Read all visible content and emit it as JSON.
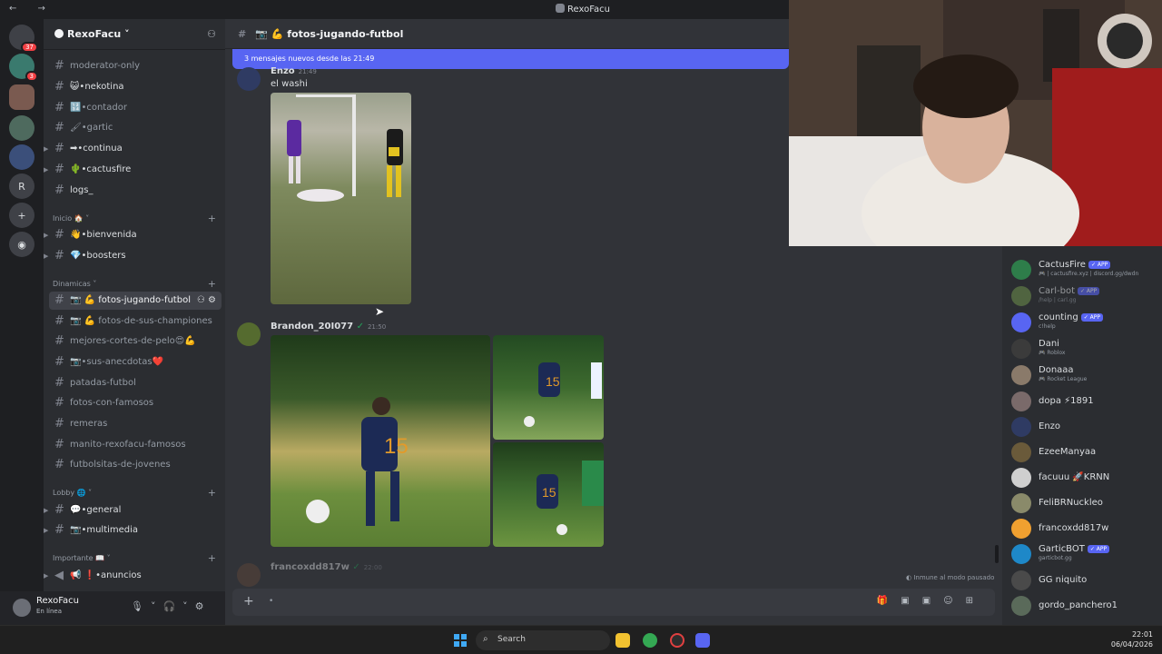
{
  "window": {
    "title": "RexoFacu"
  },
  "guilds": [
    {
      "label": "",
      "badge": "37"
    },
    {
      "label": "",
      "badge": "3"
    },
    {
      "label": "",
      "badge": ""
    },
    {
      "label": "",
      "badge": ""
    },
    {
      "label": "",
      "badge": ""
    },
    {
      "label": "R",
      "badge": ""
    },
    {
      "label": "+",
      "badge": ""
    },
    {
      "label": "",
      "badge": ""
    }
  ],
  "server": {
    "name": "RexoFacu"
  },
  "channels": [
    {
      "name": "moderator-only"
    },
    {
      "name": "😺•nekotina"
    },
    {
      "name": "🔢•contador"
    },
    {
      "name": "🖌•gartic"
    },
    {
      "name": "➡•continua"
    },
    {
      "name": "🌵•cactusfire"
    },
    {
      "name": "logs_"
    }
  ],
  "categories": {
    "inicio": "Inicio 🏠",
    "dinamicas": "Dinamicas",
    "lobby": "Lobby 🌐",
    "importante": "Importante 📖"
  },
  "inicio_channels": [
    {
      "name": "👋•bienvenida"
    },
    {
      "name": "💎•boosters"
    }
  ],
  "dinamicas_channels": [
    {
      "name": "📷 💪 fotos-jugando-futbol"
    },
    {
      "name": "📷 💪 fotos-de-sus-championes"
    },
    {
      "name": "mejores-cortes-de-pelo😍💪"
    },
    {
      "name": "📷•sus-anecdotas❤️"
    },
    {
      "name": "patadas-futbol"
    },
    {
      "name": "fotos-con-famosos"
    },
    {
      "name": "remeras"
    },
    {
      "name": "manito-rexofacu-famosos"
    },
    {
      "name": "futbolsitas-de-jovenes"
    }
  ],
  "lobby_channels": [
    {
      "name": "💬•general"
    },
    {
      "name": "📷•multimedia"
    }
  ],
  "importante_channels": [
    {
      "name": "📢 ❗•anuncios"
    }
  ],
  "user": {
    "name": "RexoFacu",
    "status": "En línea"
  },
  "channel_header": {
    "name": "📷 💪 fotos-jugando-futbol"
  },
  "new_messages_bar": "3 mensajes nuevos desde las 21:49",
  "messages": [
    {
      "author": "Enzo",
      "time": "21:49",
      "text": "el washi"
    },
    {
      "author": "Brandon_20I077",
      "time": "21:50",
      "text": ""
    },
    {
      "author": "francoxdd817w",
      "time": "22:00",
      "text": ""
    }
  ],
  "members": [
    {
      "name": "CactusFire",
      "app": "✓ APP",
      "sub": "🎮 | cactusfire.xyz | discord.gg/dwdn"
    },
    {
      "name": "Carl-bot",
      "app": "✓ APP",
      "sub": "/help | carl.gg"
    },
    {
      "name": "counting",
      "app": "✓ APP",
      "sub": "c!help"
    },
    {
      "name": "Dani",
      "app": "",
      "sub": "🎮 Roblox"
    },
    {
      "name": "Donaaa",
      "app": "",
      "sub": "🎮 Rocket League"
    },
    {
      "name": "dopa ⚡1891",
      "app": "",
      "sub": ""
    },
    {
      "name": "Enzo",
      "app": "",
      "sub": ""
    },
    {
      "name": "EzeeManyaa",
      "app": "",
      "sub": ""
    },
    {
      "name": "facuuu 🚀KRNN",
      "app": "",
      "sub": ""
    },
    {
      "name": "FeliBRNuckleo",
      "app": "",
      "sub": ""
    },
    {
      "name": "francoxdd817w",
      "app": "",
      "sub": ""
    },
    {
      "name": "GarticBOT",
      "app": "✓ APP",
      "sub": "garticbot.gg"
    },
    {
      "name": "GG niquito",
      "app": "",
      "sub": ""
    },
    {
      "name": "gordo_panchero1",
      "app": "",
      "sub": ""
    }
  ],
  "composer": {
    "placeholder": "•"
  },
  "paused_text": "Inmune al modo pausado",
  "taskbar": {
    "search": "Search",
    "time": "22:01",
    "date": "06/04/2026"
  },
  "colors": {
    "blurple": "#5865f2",
    "sidebar": "#2b2d31",
    "chat": "#313338",
    "rail": "#1e1f22"
  }
}
